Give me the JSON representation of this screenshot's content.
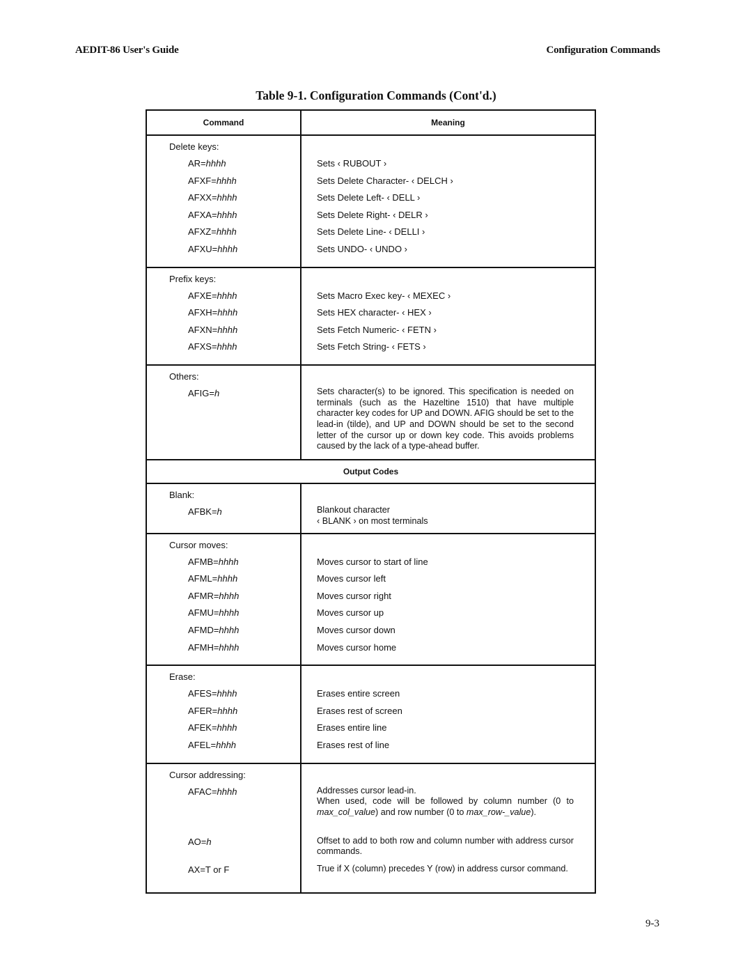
{
  "header": {
    "left": "AEDIT-86 User's Guide",
    "right": "Configuration Commands"
  },
  "table": {
    "title": "Table 9-1.  Configuration Commands (Cont'd.)",
    "columns": [
      "Command",
      "Meaning"
    ],
    "groups": [
      {
        "label": "Delete keys:",
        "rows": [
          {
            "cmd": "AR=",
            "arg": "hhhh",
            "meaning": "Sets ‹ RUBOUT ›"
          },
          {
            "cmd": "AFXF=",
            "arg": "hhhh",
            "meaning": "Sets Delete Character- ‹ DELCH ›"
          },
          {
            "cmd": "AFXX=",
            "arg": "hhhh",
            "meaning": "Sets Delete Left- ‹ DELL ›"
          },
          {
            "cmd": "AFXA=",
            "arg": "hhhh",
            "meaning": "Sets Delete Right- ‹ DELR ›"
          },
          {
            "cmd": "AFXZ=",
            "arg": "hhhh",
            "meaning": "Sets Delete Line- ‹ DELLI ›"
          },
          {
            "cmd": "AFXU=",
            "arg": "hhhh",
            "meaning": "Sets UNDO- ‹ UNDO ›"
          }
        ]
      },
      {
        "label": "Prefix keys:",
        "rows": [
          {
            "cmd": "AFXE=",
            "arg": "hhhh",
            "meaning": "Sets Macro Exec key- ‹ MEXEC ›"
          },
          {
            "cmd": "AFXH=",
            "arg": "hhhh",
            "meaning": "Sets HEX character- ‹ HEX ›"
          },
          {
            "cmd": "AFXN=",
            "arg": "hhhh",
            "meaning": "Sets Fetch Numeric- ‹ FETN ›"
          },
          {
            "cmd": "AFXS=",
            "arg": "hhhh",
            "meaning": "Sets Fetch String- ‹ FETS ›"
          }
        ]
      },
      {
        "label": "Others:",
        "rows": [
          {
            "cmd": "AFIG=",
            "arg": "h",
            "meaning": "Sets character(s) to be ignored. This specification is needed on terminals (such as the Hazeltine 1510) that have multiple character key codes for UP and DOWN. AFIG should be set to the lead-in (tilde), and UP and DOWN should be set to the second letter of the cursor up or down key code. This avoids problems caused by the lack of a type-ahead buffer."
          }
        ]
      }
    ],
    "section_header": "Output Codes",
    "output_groups": [
      {
        "label": "Blank:",
        "rows": [
          {
            "cmd": "AFBK=",
            "arg": "h",
            "meaning_line1": "Blankout character",
            "meaning_line2": "‹ BLANK ›  on most terminals"
          }
        ]
      },
      {
        "label": "Cursor moves:",
        "rows": [
          {
            "cmd": "AFMB=",
            "arg": "hhhh",
            "meaning": "Moves cursor to start of line"
          },
          {
            "cmd": "AFML=",
            "arg": "hhhh",
            "meaning": "Moves cursor left"
          },
          {
            "cmd": "AFMR=",
            "arg": "hhhh",
            "meaning": "Moves cursor right"
          },
          {
            "cmd": "AFMU=",
            "arg": "hhhh",
            "meaning": "Moves cursor up"
          },
          {
            "cmd": "AFMD=",
            "arg": "hhhh",
            "meaning": "Moves cursor down"
          },
          {
            "cmd": "AFMH=",
            "arg": "hhhh",
            "meaning": "Moves cursor home"
          }
        ]
      },
      {
        "label": "Erase:",
        "rows": [
          {
            "cmd": "AFES=",
            "arg": "hhhh",
            "meaning": "Erases entire screen"
          },
          {
            "cmd": "AFER=",
            "arg": "hhhh",
            "meaning": "Erases rest of screen"
          },
          {
            "cmd": "AFEK=",
            "arg": "hhhh",
            "meaning": "Erases entire line"
          },
          {
            "cmd": "AFEL=",
            "arg": "hhhh",
            "meaning": "Erases rest of line"
          }
        ]
      },
      {
        "label": "Cursor addressing:",
        "rows": [
          {
            "cmd": "AFAC=",
            "arg": "hhhh",
            "meaning_line1": "Addresses cursor lead-in.",
            "meaning_part1": "When used, code will be followed by column number (0 to ",
            "meaning_italic1": "max_col_value",
            "meaning_part2": ") and row number (0 to ",
            "meaning_italic2": "max_row-_value",
            "meaning_part3": ")."
          },
          {
            "cmd": "AO=",
            "arg": "h",
            "meaning": "Offset to add to both row and column number with address cursor commands."
          },
          {
            "cmd": "AX=T or F",
            "arg": "",
            "meaning": "True if X (column) precedes Y (row) in address cursor command."
          }
        ]
      }
    ]
  },
  "footer": {
    "page_number": "9-3"
  }
}
